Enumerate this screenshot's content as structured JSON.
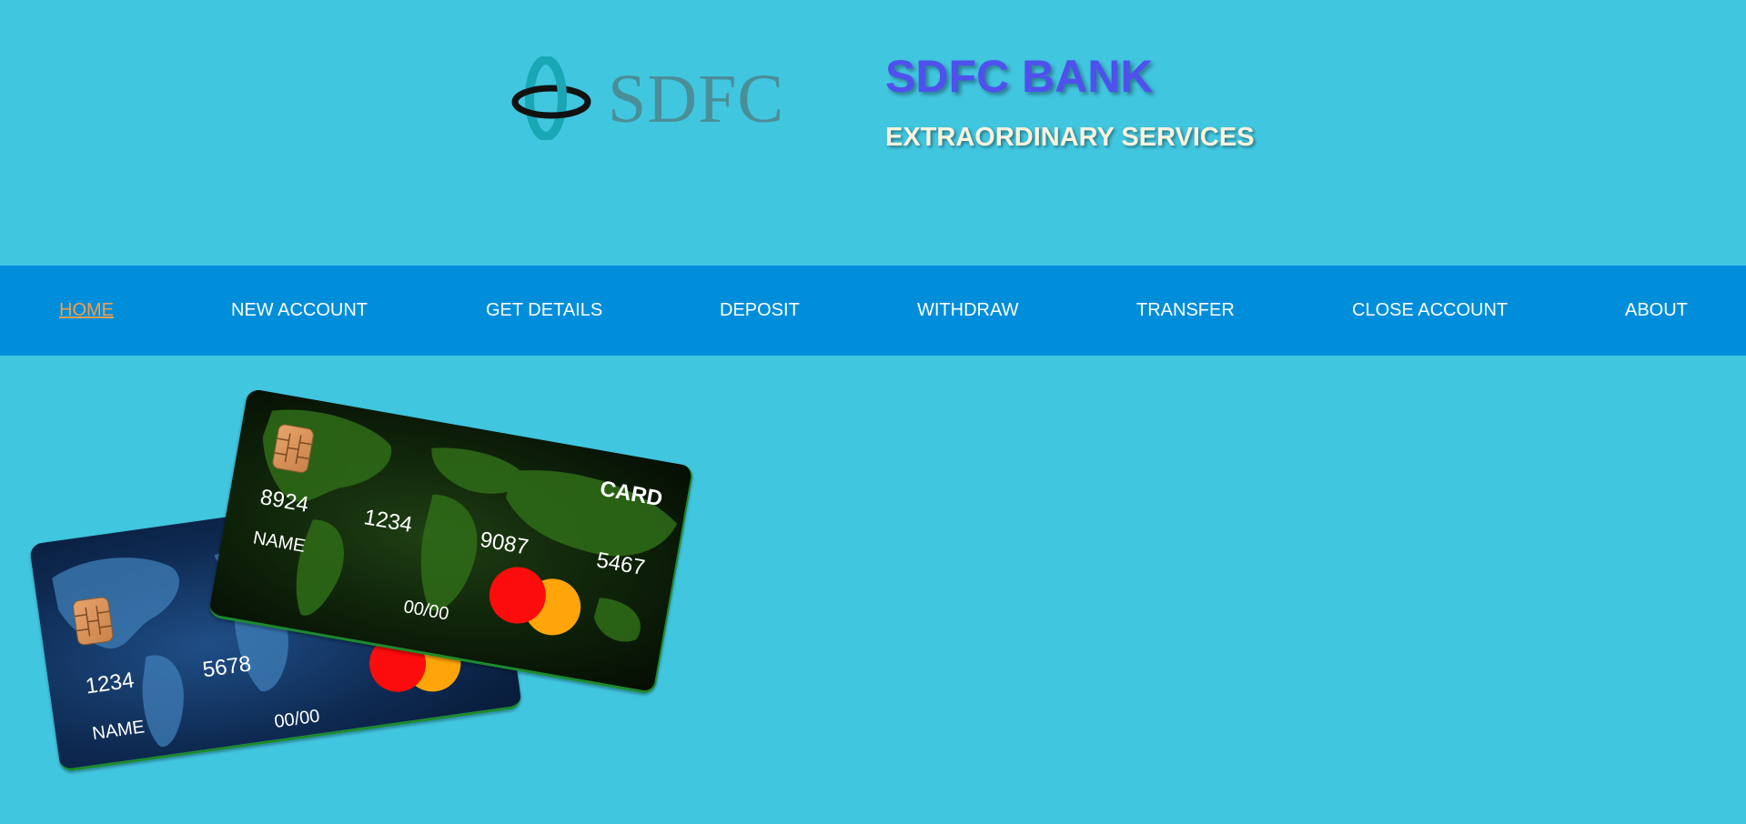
{
  "header": {
    "logo_text": "SDFC",
    "title": "SDFC BANK",
    "tagline": "EXTRAORDINARY SERVICES"
  },
  "nav": {
    "items": [
      {
        "label": "HOME",
        "active": true
      },
      {
        "label": "NEW ACCOUNT",
        "active": false
      },
      {
        "label": "GET DETAILS",
        "active": false
      },
      {
        "label": "DEPOSIT",
        "active": false
      },
      {
        "label": "WITHDRAW",
        "active": false
      },
      {
        "label": "TRANSFER",
        "active": false
      },
      {
        "label": "CLOSE ACCOUNT",
        "active": false
      },
      {
        "label": "ABOUT",
        "active": false
      }
    ]
  },
  "cards": {
    "back": {
      "number_group_1": "1234",
      "number_group_2": "5678",
      "name": "NAME",
      "expiry": "00/00"
    },
    "front": {
      "brand": "CARD",
      "number_group_1": "8924",
      "number_group_2": "1234",
      "number_group_3": "9087",
      "number_group_4": "5467",
      "name": "NAME",
      "expiry": "00/00"
    }
  },
  "colors": {
    "background": "#41c6e0",
    "nav_background": "#008edb",
    "nav_active": "#f0a04e",
    "title": "#5050ee",
    "tagline": "#fbf3dc"
  }
}
